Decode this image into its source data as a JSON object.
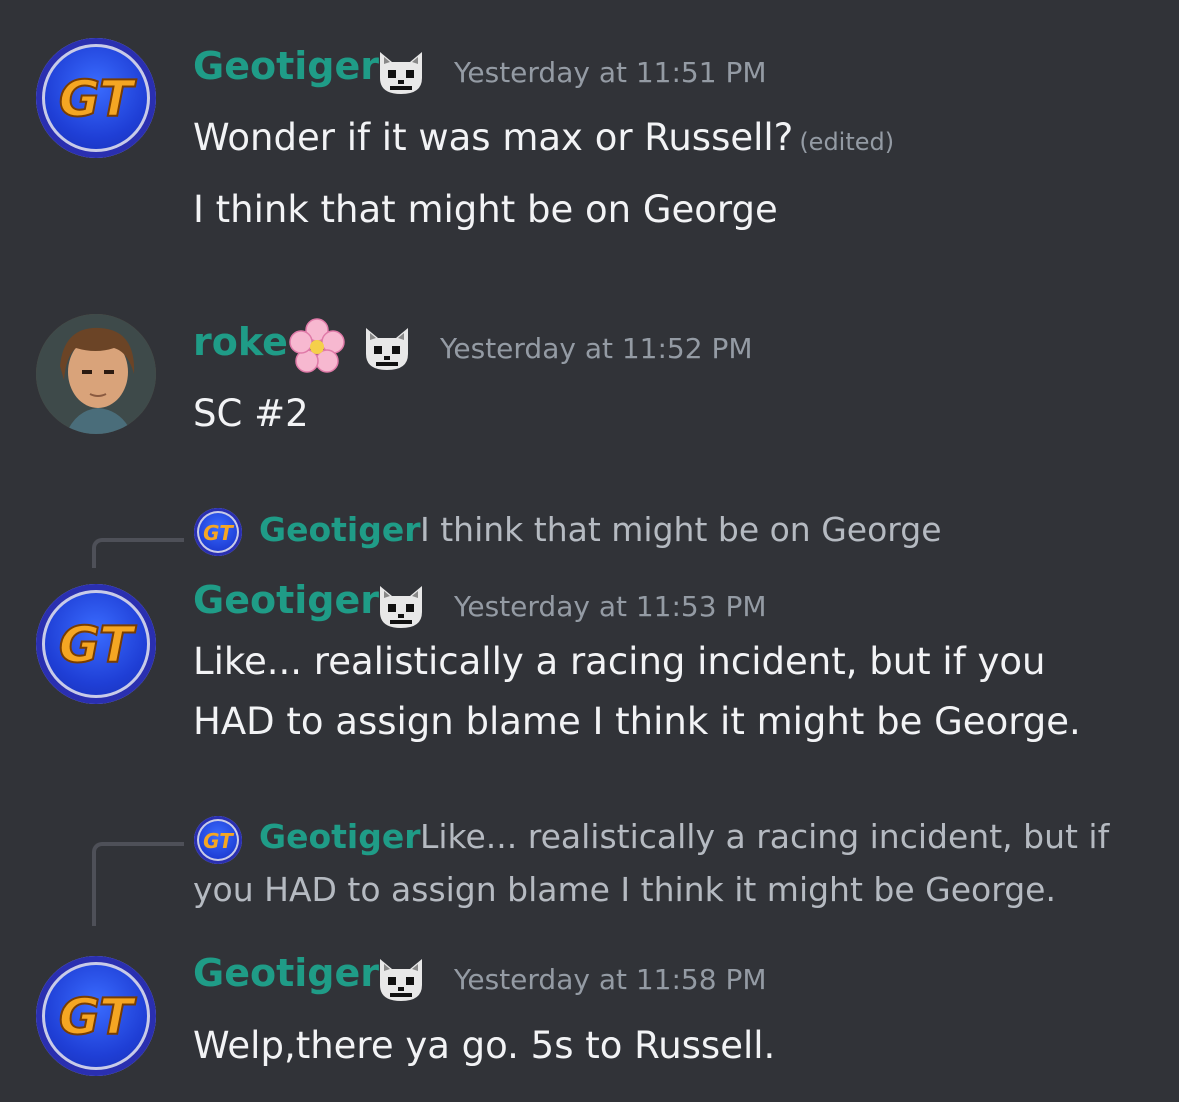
{
  "messages": [
    {
      "author": "Geotiger",
      "timestamp": "Yesterday at 11:51 PM",
      "lines": [
        "Wonder if it was max or Russell?",
        "I think that might be on George"
      ],
      "edited_label": "(edited)"
    },
    {
      "author": "roke",
      "timestamp": "Yesterday at 11:52 PM",
      "lines": [
        "SC #2"
      ]
    },
    {
      "author": "Geotiger",
      "timestamp": "Yesterday at 11:53 PM",
      "reply": {
        "author": "Geotiger",
        "text": "I think that might be on George"
      },
      "lines": [
        "Like... realistically a racing incident, but if you",
        "HAD to assign blame I think it might be George."
      ]
    },
    {
      "author": "Geotiger",
      "timestamp": "Yesterday at 11:58 PM",
      "reply": {
        "author": "Geotiger",
        "text_line1": "Like... realistically a racing incident, but if",
        "text_line2": "you HAD to assign blame I think it might be George."
      },
      "lines": [
        "Welp,there ya go.  5s to Russell."
      ]
    }
  ],
  "avatar_monogram": "GT",
  "colors": {
    "background": "#313338",
    "username": "#1f9c87",
    "timestamp": "#949ba4",
    "text": "#f2f3f5"
  }
}
